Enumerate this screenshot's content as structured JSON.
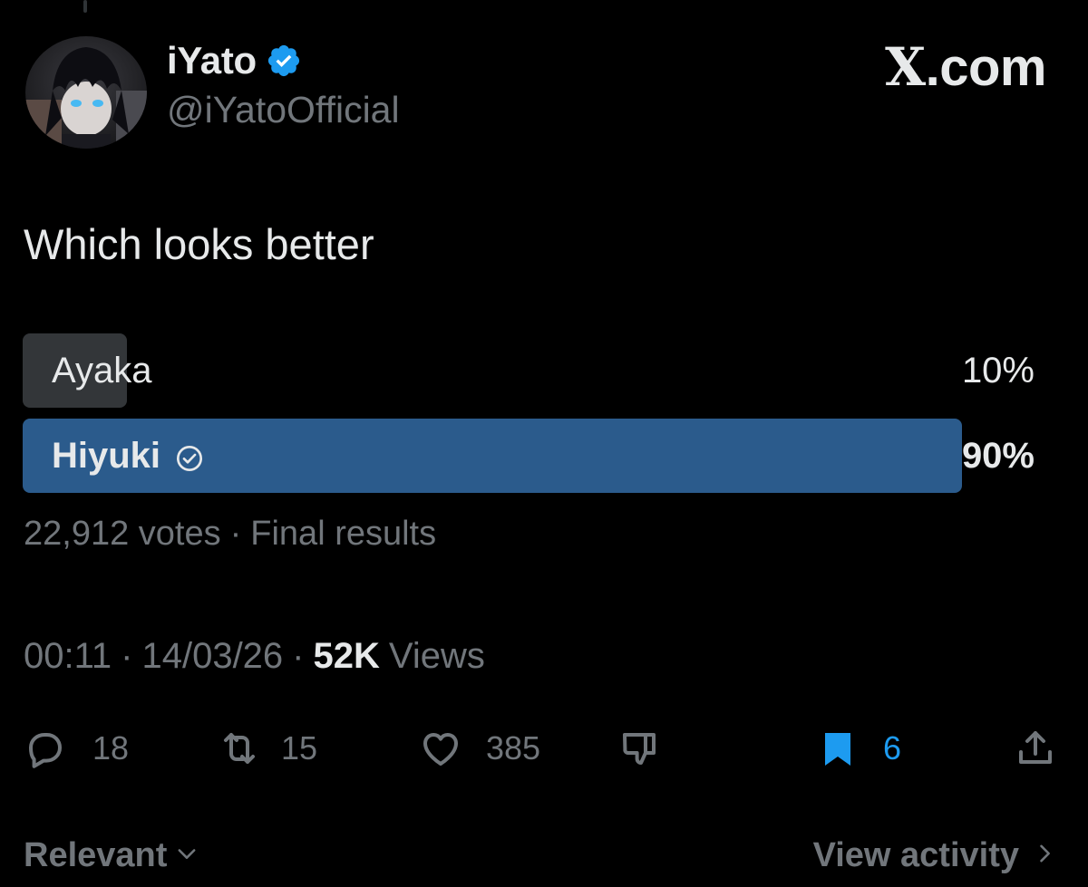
{
  "author": {
    "display_name": "iYato",
    "handle": "@iYatoOfficial",
    "verified": true,
    "avatar_icon": "anime-character-avatar"
  },
  "brand": {
    "logo_text": ".com",
    "logo_letter": "X"
  },
  "tweet": {
    "text": "Which looks better"
  },
  "poll": {
    "options": [
      {
        "label": "Ayaka",
        "percent_text": "10%",
        "percent": 10,
        "winner": false
      },
      {
        "label": "Hiyuki",
        "percent_text": "90%",
        "percent": 90,
        "winner": true
      }
    ],
    "votes": "22,912 votes",
    "separator": "·",
    "status": "Final results"
  },
  "meta": {
    "time": "00:11",
    "date": "14/03/26",
    "views_count": "52K",
    "views_label": "Views",
    "separator": "·"
  },
  "actions": {
    "replies": "18",
    "reposts": "15",
    "likes": "385",
    "bookmarks": "6"
  },
  "footer": {
    "sort_label": "Relevant",
    "activity_label": "View activity"
  },
  "colors": {
    "background": "#000000",
    "text": "#e7e9ea",
    "muted": "#71767b",
    "accent": "#1d9bf0",
    "poll_winner": "#2b5b8c",
    "poll_loser": "#333639"
  }
}
